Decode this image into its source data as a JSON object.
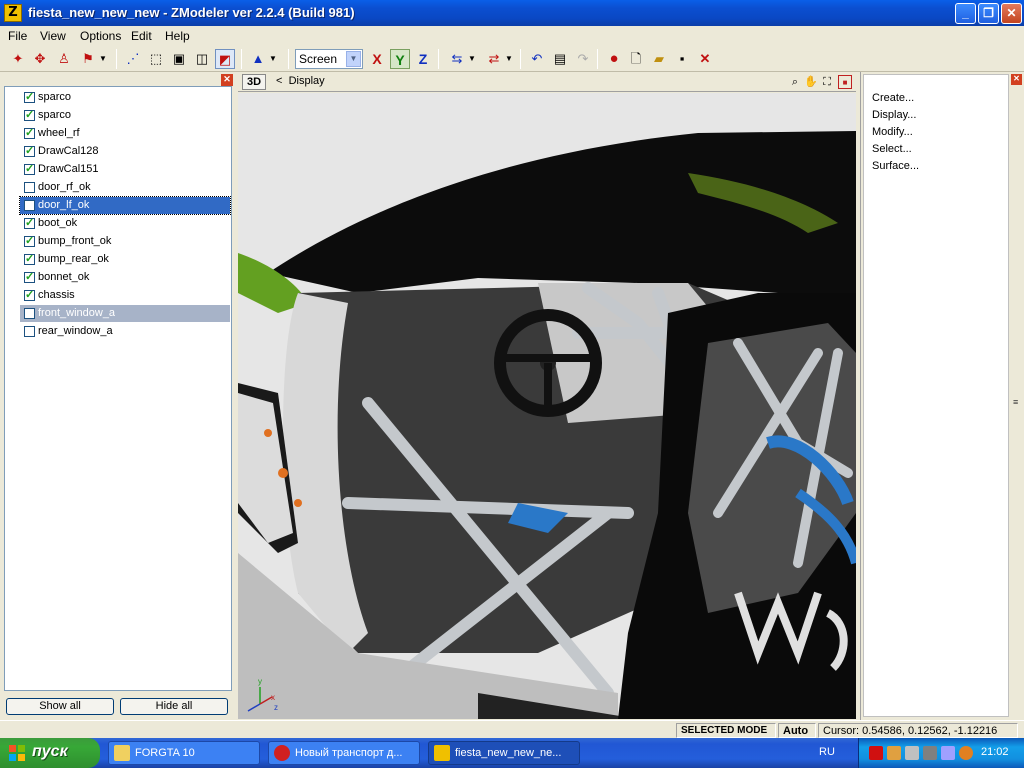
{
  "window": {
    "title": "fiesta_new_new_new - ZModeler ver 2.2.4 (Build 981)"
  },
  "menu": [
    "File",
    "View",
    "Options",
    "Edit",
    "Help"
  ],
  "toolbar": {
    "coord_mode": "Screen",
    "axes": [
      "X",
      "Y",
      "Z"
    ],
    "active_axis": "Y"
  },
  "objects": [
    {
      "name": "sparco",
      "checked": true
    },
    {
      "name": "sparco",
      "checked": true
    },
    {
      "name": "wheel_rf",
      "checked": true
    },
    {
      "name": "DrawCal128",
      "checked": true
    },
    {
      "name": "DrawCal151",
      "checked": true
    },
    {
      "name": "door_rf_ok",
      "checked": false
    },
    {
      "name": "door_lf_ok",
      "checked": false,
      "selected": true
    },
    {
      "name": "boot_ok",
      "checked": true
    },
    {
      "name": "bump_front_ok",
      "checked": true
    },
    {
      "name": "bump_rear_ok",
      "checked": true
    },
    {
      "name": "bonnet_ok",
      "checked": true
    },
    {
      "name": "chassis",
      "checked": true
    },
    {
      "name": "front_window_a",
      "checked": false,
      "highlighted": true
    },
    {
      "name": "rear_window_a",
      "checked": false
    }
  ],
  "list_buttons": {
    "show_all": "Show all",
    "hide_all": "Hide all"
  },
  "viewport": {
    "mode_tag": "3D",
    "nav_label": "Display",
    "gizmo_labels": [
      "y",
      "x",
      "z"
    ]
  },
  "command_panel": [
    "Create...",
    "Display...",
    "Modify...",
    "Select...",
    "Surface..."
  ],
  "status": {
    "mode": "SELECTED MODE",
    "auto": "Auto",
    "cursor": "Cursor: 0.54586, 0.12562, -1.12216"
  },
  "taskbar": {
    "start": "пуск",
    "tasks": [
      {
        "label": "FORGTA 10",
        "icon": "folder-icon"
      },
      {
        "label": "Новый транспорт д...",
        "icon": "opera-icon"
      },
      {
        "label": "fiesta_new_new_ne...",
        "icon": "zmodeler-icon",
        "active": true
      }
    ],
    "lang": "RU",
    "clock": "21:02"
  }
}
